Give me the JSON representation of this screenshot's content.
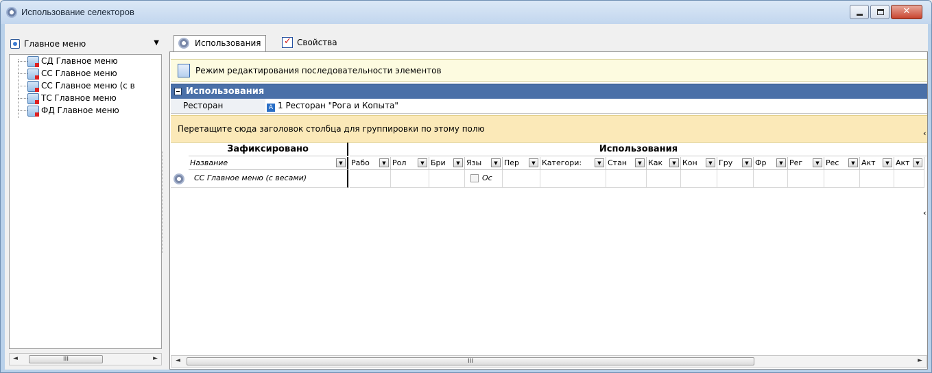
{
  "window": {
    "title": "Использование селекторов",
    "accent": "#4a70a8"
  },
  "left": {
    "combo_label": "Главное меню",
    "tree": [
      {
        "label": "СД Главное меню"
      },
      {
        "label": "СС Главное меню"
      },
      {
        "label": "СС Главное меню (с в"
      },
      {
        "label": "ТС Главное меню"
      },
      {
        "label": "ФД Главное меню"
      }
    ]
  },
  "tabs": [
    {
      "label": "Использования",
      "icon": "gear-icon",
      "active": true
    },
    {
      "label": "Свойства",
      "icon": "properties-icon",
      "active": false
    }
  ],
  "infobar": {
    "text": "Режим редактирования последовательности элементов"
  },
  "group": {
    "title": "Использования",
    "prop_label": "Ресторан",
    "prop_value": "1 Ресторан \"Рога и Копыта\"",
    "prop_icon_letter": "A"
  },
  "dragzone": {
    "text": "Перетащите сюда заголовок столбца для группировки по этому полю"
  },
  "grid": {
    "band_fixed": "Зафиксировано",
    "band_use": "Использования",
    "fixed_col": "Название",
    "columns": [
      "Рабо",
      "Рол",
      "Бри",
      "Язы",
      "Пер",
      "Категори:",
      "Стан",
      "Как",
      "Кон",
      "Гру",
      "Фр",
      "Рег",
      "Рес",
      "Акт",
      "Акт"
    ],
    "row": {
      "name": "СС Главное меню (с весами)",
      "lang_value": "Ос"
    }
  }
}
